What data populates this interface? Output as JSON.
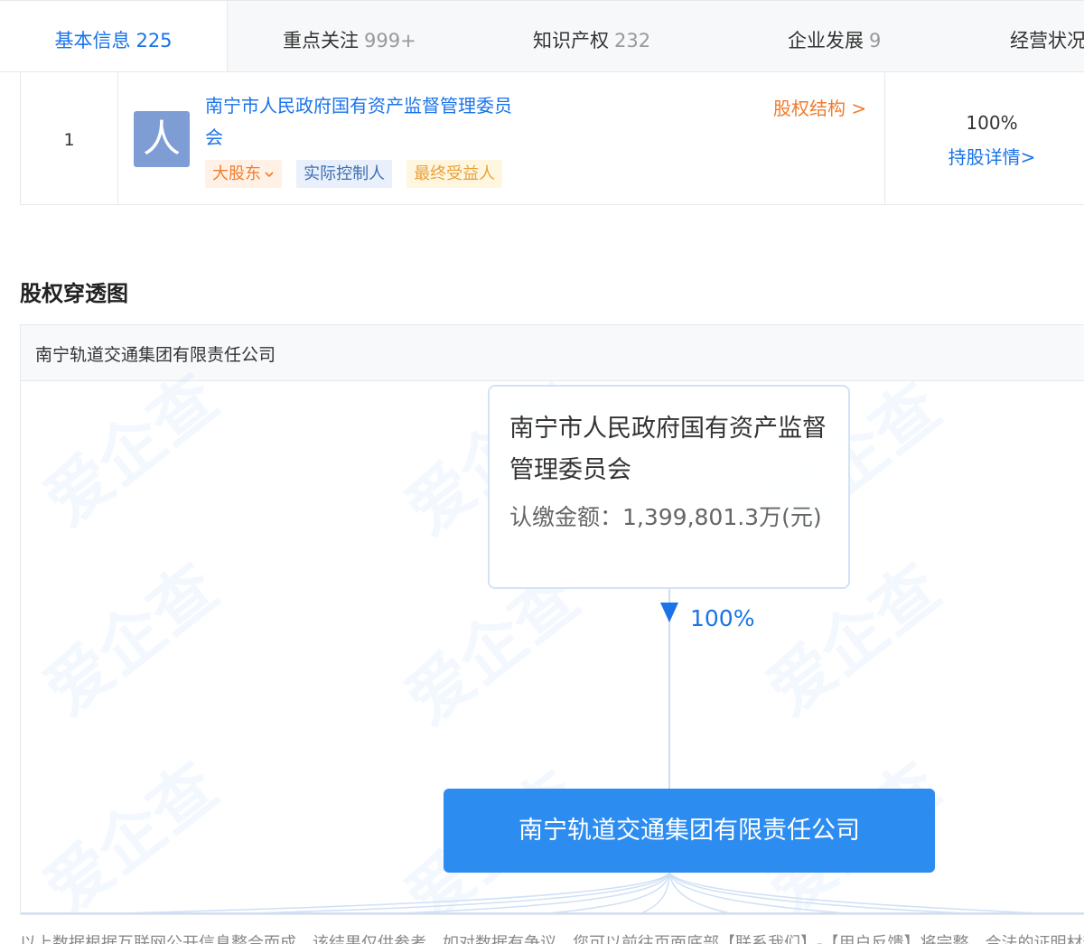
{
  "tabs": [
    {
      "label": "基本信息",
      "count": "225",
      "active": true
    },
    {
      "label": "重点关注",
      "count": "999+"
    },
    {
      "label": "知识产权",
      "count": "232"
    },
    {
      "label": "企业发展",
      "count": "9"
    },
    {
      "label": "经营状况",
      "count": ""
    }
  ],
  "shareholder": {
    "index": "1",
    "avatar_char": "人",
    "name": "南宁市人民政府国有资产监督管理委员会",
    "structure_link": "股权结构 >",
    "tags": {
      "major": "大股东",
      "controller": "实际控制人",
      "beneficiary": "最终受益人"
    },
    "percent": "100%",
    "detail_link": "持股详情>"
  },
  "penetration": {
    "section_title": "股权穿透图",
    "panel_header": "南宁轨道交通集团有限责任公司",
    "watermark": "爱企查",
    "top_node": {
      "name": "南宁市人民政府国有资产监督管理委员会",
      "amount": "认缴金额：1,399,801.3万(元)"
    },
    "edge_percent": "100%",
    "company_node": "南宁轨道交通集团有限责任公司"
  },
  "footer_text": "以上数据根据互联网公开信息整合而成，该结果仅供参考，如对数据有争议，您可以前往页面底部【联系我们】-【用户反馈】将完整、合法的证明材料提交给我们"
}
